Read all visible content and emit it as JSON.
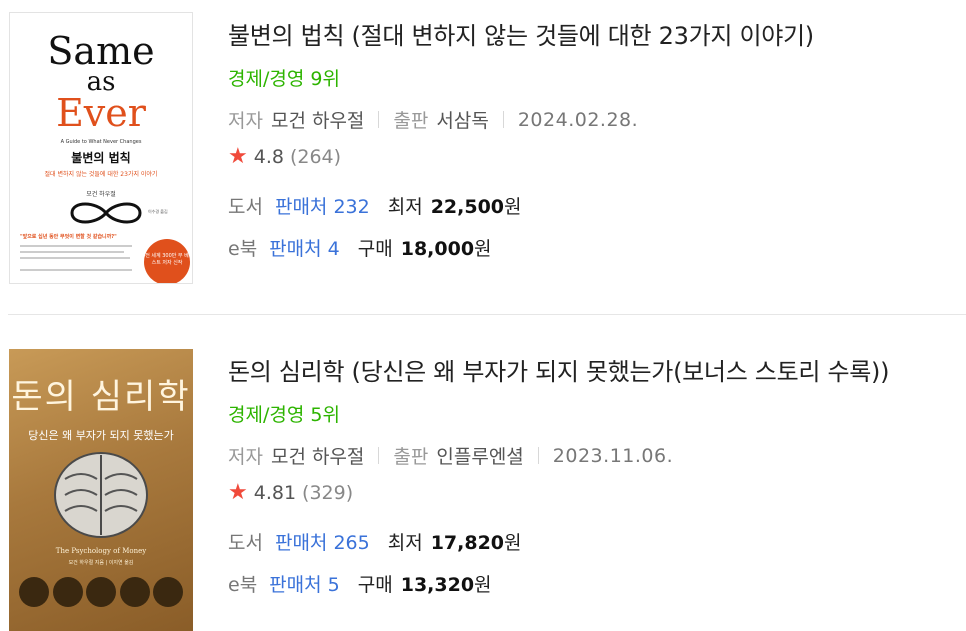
{
  "books": [
    {
      "title": "불변의 법칙 (절대 변하지 않는 것들에 대한 23가지 이야기)",
      "rank": "경제/경영 9위",
      "author_label": "저자",
      "author": "모건 하우절",
      "publisher_label": "출판",
      "publisher": "서삼독",
      "date": "2024.02.28.",
      "rating": "4.8",
      "review_count": "(264)",
      "print": {
        "kind": "도서",
        "sellers": "판매처 232",
        "price_label": "최저",
        "price": "22,500",
        "unit": "원"
      },
      "ebook": {
        "kind": "e북",
        "sellers": "판매처 4",
        "price_label": "구매",
        "price": "18,000",
        "unit": "원"
      },
      "cover": {
        "title_line1": "Same",
        "title_line2": "as",
        "title_line3": "Ever",
        "tagline": "A Guide to What Never Changes",
        "ko_title": "불변의 법칙",
        "ko_subtitle": "절대 변하지 않는 것들에 대한 23가지 이야기",
        "ko_author": "모건 하우절",
        "translator": "이수경 옮김",
        "quote": "\"앞으로 십년 동안 무엇이 변할 것 같습니까?\"",
        "badge": "전 세계 300만 부 베스트 저자 신작"
      }
    },
    {
      "title": "돈의 심리학 (당신은 왜 부자가 되지 못했는가(보너스 스토리 수록))",
      "rank": "경제/경영 5위",
      "author_label": "저자",
      "author": "모건 하우절",
      "publisher_label": "출판",
      "publisher": "인플루엔셜",
      "date": "2023.11.06.",
      "rating": "4.81",
      "review_count": "(329)",
      "print": {
        "kind": "도서",
        "sellers": "판매처 265",
        "price_label": "최저",
        "price": "17,820",
        "unit": "원"
      },
      "ebook": {
        "kind": "e북",
        "sellers": "판매처 5",
        "price_label": "구매",
        "price": "13,320",
        "unit": "원"
      },
      "cover": {
        "ko_title": "돈의 심리학",
        "ko_subtitle": "당신은 왜 부자가 되지 못했는가",
        "en_title": "The Psychology of Money",
        "author_line": "모건 하우절 지음 | 이지연 옮김"
      }
    }
  ],
  "colors": {
    "rank_green": "#2db400",
    "seller_blue": "#3a72d9",
    "star_red": "#f04a3b",
    "accent_orange": "#e0501c"
  },
  "icons": {
    "rating": "star-icon"
  }
}
